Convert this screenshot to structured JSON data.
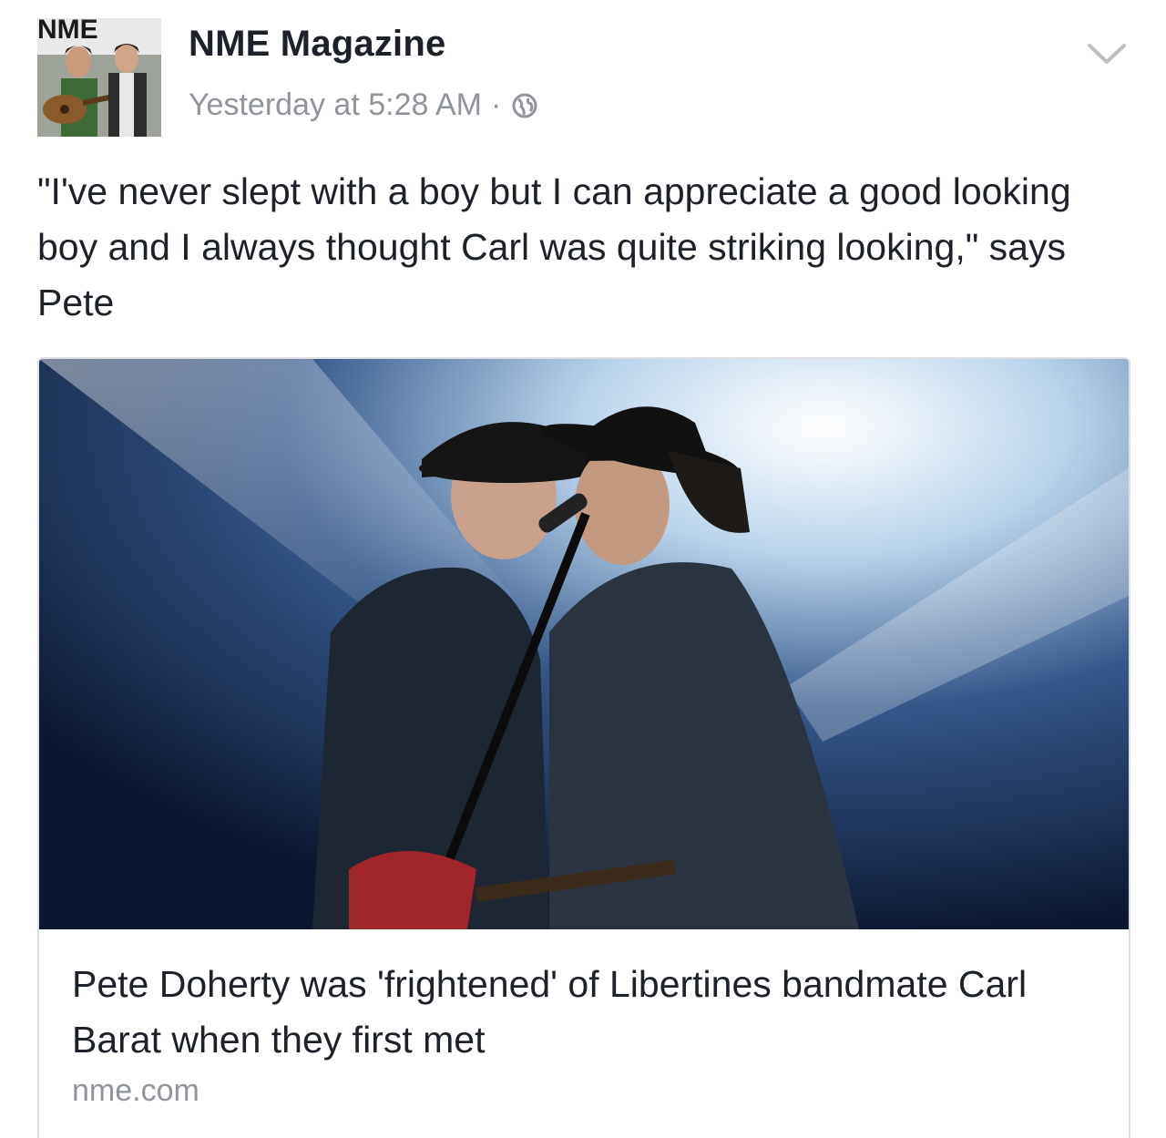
{
  "post": {
    "page_name": "NME Magazine",
    "timestamp": "Yesterday at 5:28 AM",
    "separator": "·",
    "privacy_icon": "globe-icon",
    "menu_icon": "chevron-down-icon",
    "avatar_logo_text": "NME",
    "text": "\"I've never slept with a boy but I can appreciate a good looking boy and I always thought Carl was quite striking looking,\" says Pete"
  },
  "link_card": {
    "title": "Pete Doherty was 'frightened' of Libertines bandmate Carl Barat when they first met",
    "domain": "nme.com"
  },
  "colors": {
    "text_primary": "#1d2129",
    "text_secondary": "#90949c",
    "card_border": "#dddfe2"
  }
}
